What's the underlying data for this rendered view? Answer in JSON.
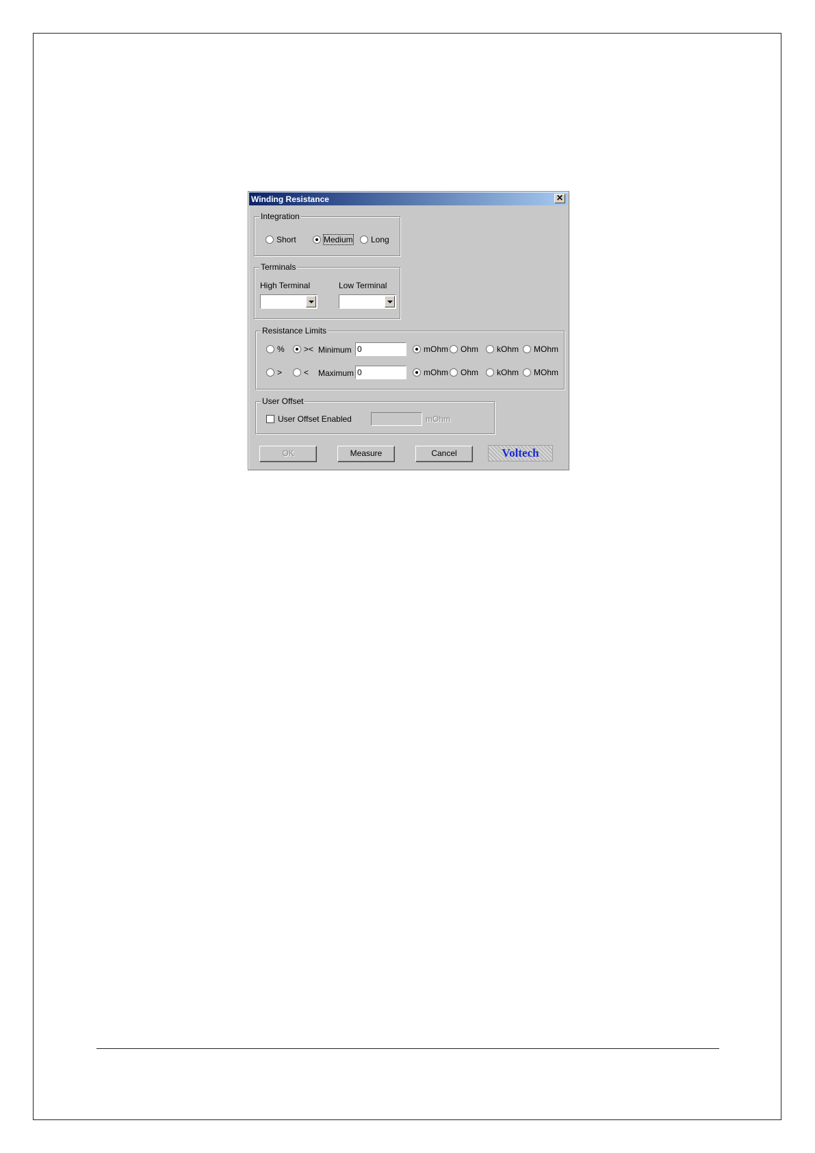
{
  "dialog": {
    "title": "Winding Resistance",
    "close_glyph": "✕",
    "integration": {
      "label": "Integration",
      "options": [
        "Short",
        "Medium",
        "Long"
      ],
      "selected": "Medium"
    },
    "terminals": {
      "label": "Terminals",
      "high_label": "High Terminal",
      "high_value": "",
      "low_label": "Low Terminal",
      "low_value": ""
    },
    "limits": {
      "label": "Resistance Limits",
      "row1": {
        "opt_a": "%",
        "opt_b": "><",
        "field_label": "Minimum",
        "value": "0",
        "selected_mode": "><"
      },
      "row2": {
        "opt_a": ">",
        "opt_b": "<",
        "field_label": "Maximum",
        "value": "0",
        "selected_mode": "none"
      },
      "units": [
        "mOhm",
        "Ohm",
        "kOhm",
        "MOhm"
      ],
      "selected_unit": "mOhm"
    },
    "user_offset": {
      "label": "User Offset",
      "checkbox_label": "User Offset Enabled",
      "checked": false,
      "value": "",
      "unit": "mOhm"
    },
    "buttons": {
      "ok": "OK",
      "measure": "Measure",
      "cancel": "Cancel"
    },
    "logo_text": "Voltech"
  },
  "colors": {
    "dialog_bg": "#c8c8c8",
    "title_start": "#0a246a",
    "title_end": "#a6caf0",
    "logo_text": "#1a2ad0"
  }
}
